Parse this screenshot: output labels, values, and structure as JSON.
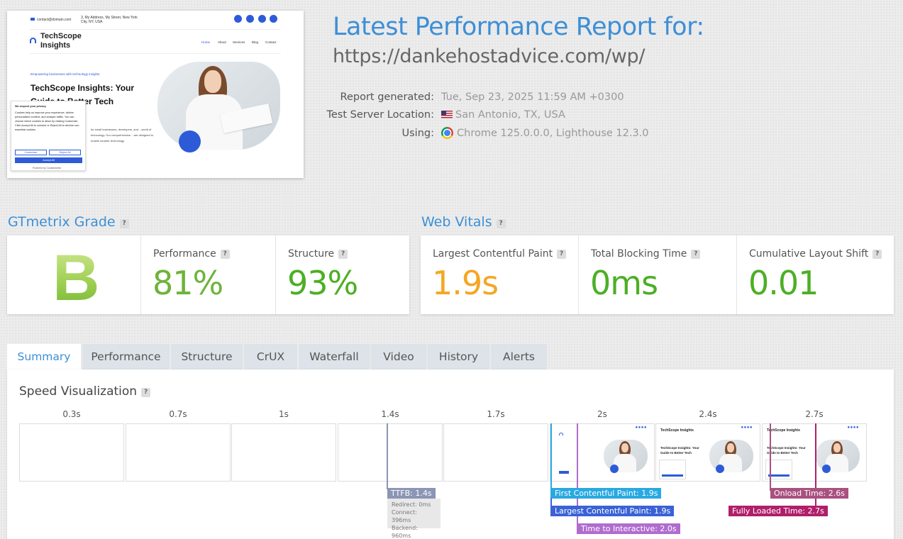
{
  "thumbnail": {
    "email": "contact@domain.com",
    "address": "3, My Address, My Street, New York City, NY, USA",
    "logo": "TechScope Insights",
    "nav": [
      "Home",
      "About",
      "Services",
      "Blog",
      "Contact"
    ],
    "tagline": "Empowering businesses with technology insights",
    "hero_title": "TechScope Insights: Your Guide to Better Tech",
    "hero_text": "for small businesses, developers, and ...world of technology. Our comprehensive ...are designed to enable smarter technology",
    "cookie": {
      "title": "We respect your privacy",
      "text": "Cookies help us improve your experience, deliver personalized content, and analyze traffic. You can choose which cookies to allow by clicking Customize. Click Accept All to consent or Reject All to decline non-essential cookies.",
      "customize": "Customize",
      "reject": "Reject All",
      "accept": "Accept All",
      "powered": "Powered by CookieAdmin"
    }
  },
  "report": {
    "title": "Latest Performance Report for:",
    "url": "https://dankehostadvice.com/wp/",
    "generated_label": "Report generated:",
    "generated_value": "Tue, Sep 23, 2025 11:59 AM +0300",
    "location_label": "Test Server Location:",
    "location_value": "San Antonio, TX, USA",
    "using_label": "Using:",
    "using_value": "Chrome 125.0.0.0, Lighthouse 12.3.0"
  },
  "grade": {
    "title": "GTmetrix Grade",
    "letter": "B",
    "performance_label": "Performance",
    "performance_value": "81%",
    "structure_label": "Structure",
    "structure_value": "93%"
  },
  "vitals": {
    "title": "Web Vitals",
    "lcp_label": "Largest Contentful Paint",
    "lcp_value": "1.9s",
    "tbt_label": "Total Blocking Time",
    "tbt_value": "0ms",
    "cls_label": "Cumulative Layout Shift",
    "cls_value": "0.01"
  },
  "colors": {
    "accent": "#3d8fd6",
    "good": "#4caf24",
    "perf": "#6eb33a",
    "warn": "#f5a623",
    "ttfb": "#8b95b5",
    "fcp": "#29a9e1",
    "lcp": "#3a62d6",
    "tti": "#b06ccf",
    "onload": "#a9517f",
    "fully": "#b01f6b"
  },
  "tabs": [
    "Summary",
    "Performance",
    "Structure",
    "CrUX",
    "Waterfall",
    "Video",
    "History",
    "Alerts"
  ],
  "speed": {
    "title": "Speed Visualization",
    "ticks": [
      "0.3s",
      "0.7s",
      "1s",
      "1.4s",
      "1.7s",
      "2s",
      "2.4s",
      "2.7s"
    ],
    "ttfb": "TTFB: 1.4s",
    "redirect": "Redirect: 0ms",
    "connect": "Connect: 396ms",
    "backend": "Backend: 960ms",
    "fcp": "First Contentful Paint: 1.9s",
    "lcp": "Largest Contentful Paint: 1.9s",
    "tti": "Time to Interactive: 2.0s",
    "onload": "Onload Time: 2.6s",
    "fully": "Fully Loaded Time: 2.7s",
    "frame_logo": "TechScope Insights",
    "frame_title": "TechScope Insights: Your Guide to Better Tech"
  }
}
